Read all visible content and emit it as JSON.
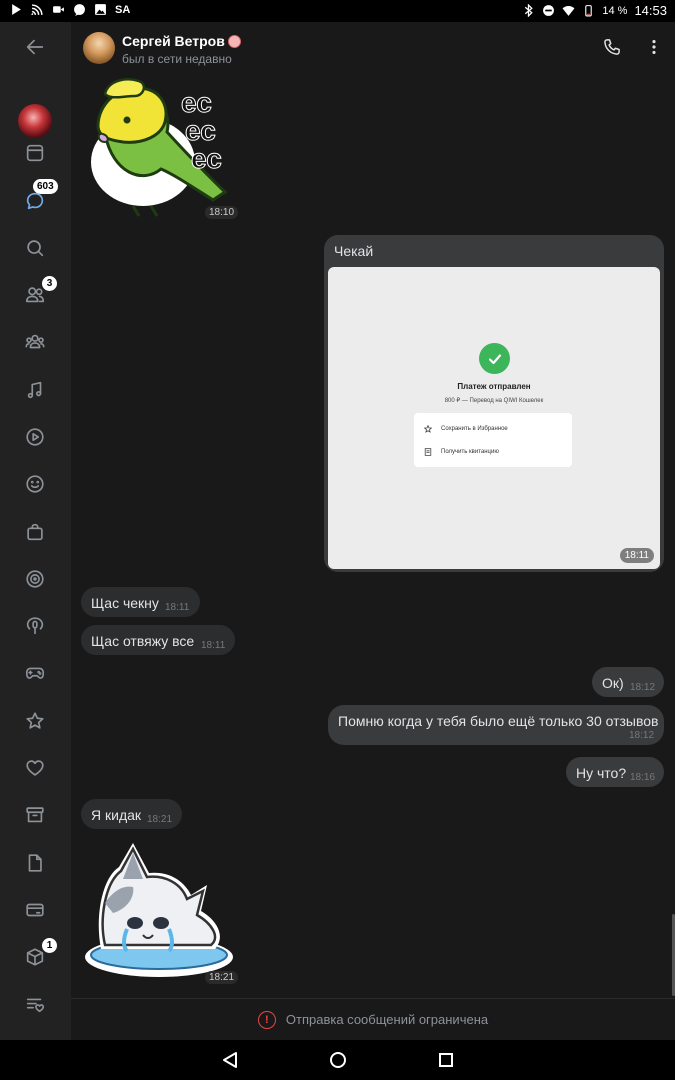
{
  "status_bar": {
    "carrier_label": "SA",
    "battery_percent": "14 %",
    "clock": "14:53",
    "icons": [
      "play-icon",
      "cast-icon",
      "video-icon",
      "message-icon",
      "image-icon",
      "bluetooth-icon",
      "dnd-icon",
      "wifi-icon",
      "battery-icon"
    ]
  },
  "rail": {
    "items": [
      {
        "icon": "back-arrow-icon"
      },
      {
        "icon": "avatar"
      },
      {
        "icon": "browser-window-icon"
      },
      {
        "icon": "chat-bubble-icon",
        "badge": "603",
        "active": true
      },
      {
        "icon": "search-icon"
      },
      {
        "icon": "friends-icon",
        "badge": "3"
      },
      {
        "icon": "communities-icon"
      },
      {
        "icon": "music-icon"
      },
      {
        "icon": "video-play-icon"
      },
      {
        "icon": "smile-icon"
      },
      {
        "icon": "shopping-bag-icon"
      },
      {
        "icon": "target-icon"
      },
      {
        "icon": "podcast-icon"
      },
      {
        "icon": "gamepad-icon"
      },
      {
        "icon": "star-icon"
      },
      {
        "icon": "heart-icon"
      },
      {
        "icon": "archive-icon"
      },
      {
        "icon": "document-icon"
      },
      {
        "icon": "card-icon"
      },
      {
        "icon": "package-icon",
        "badge": "1"
      },
      {
        "icon": "wishlist-icon"
      }
    ]
  },
  "header": {
    "name": "Сергей Ветров",
    "status": "был в сети недавно",
    "call_icon": "phone-icon",
    "menu_icon": "more-vertical-icon"
  },
  "messages": [
    {
      "type": "sticker",
      "direction": "in",
      "sticker": "parrot-ес-ес-ес",
      "sticker_text": [
        "ес",
        "ес",
        "ес"
      ],
      "time": "18:10"
    },
    {
      "type": "image",
      "direction": "out",
      "caption": "Чекай",
      "time": "18:11",
      "image": {
        "title": "Платеж отправлен",
        "subtitle": "800 ₽ — Перевод на QIWI Кошелек",
        "actions": [
          "Сохранить в Избранное",
          "Получить квитанцию"
        ]
      }
    },
    {
      "type": "text",
      "direction": "in",
      "text": "Щас чекну",
      "time": "18:11"
    },
    {
      "type": "text",
      "direction": "in",
      "text": "Щас отвяжу все",
      "time": "18:11"
    },
    {
      "type": "text",
      "direction": "out",
      "text": "Ок)",
      "time": "18:12"
    },
    {
      "type": "text",
      "direction": "out",
      "text": "Помню когда у тебя было ещё только 30 отзывов",
      "time": "18:12"
    },
    {
      "type": "text",
      "direction": "out",
      "text": "Ну что?",
      "time": "18:16"
    },
    {
      "type": "text",
      "direction": "in",
      "text": "Я кидак",
      "time": "18:21"
    },
    {
      "type": "sticker",
      "direction": "in",
      "sticker": "crying-cat",
      "time": "18:21"
    }
  ],
  "footer": {
    "restriction_text": "Отправка сообщений ограничена",
    "icon": "alert-circle-icon"
  },
  "nav_bar": {
    "icons": [
      "nav-back-icon",
      "nav-home-icon",
      "nav-recents-icon"
    ]
  },
  "colors": {
    "background": "#191919",
    "rail": "#222222",
    "bubble_in": "#2c2d2e",
    "bubble_out": "#3a3b3c",
    "accent": "#71aaeb",
    "alert": "#e64646",
    "success": "#3cb55b"
  }
}
